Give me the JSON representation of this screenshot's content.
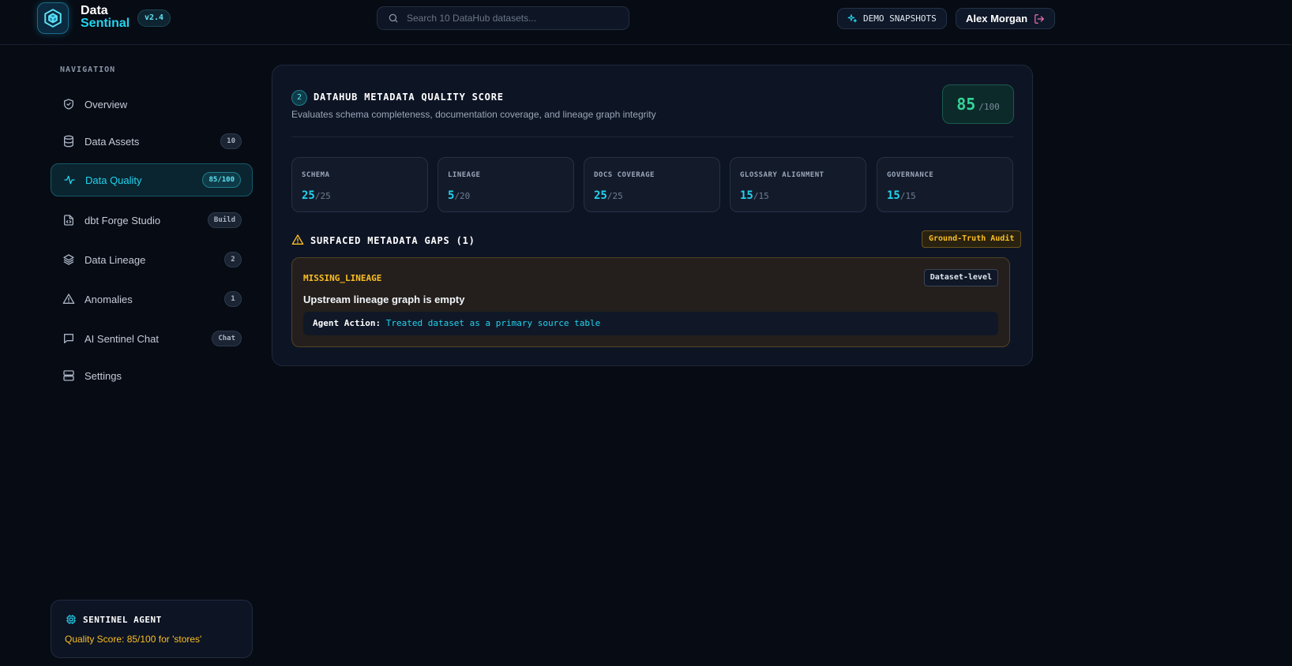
{
  "app": {
    "brand_line1": "Data",
    "brand_line2": "Sentinal",
    "version": "v2.4"
  },
  "search": {
    "placeholder": "Search 10 DataHub datasets..."
  },
  "header": {
    "demo_label": "DEMO SNAPSHOTS",
    "user_name": "Alex Morgan"
  },
  "sidebar": {
    "heading": "NAVIGATION",
    "items": [
      {
        "label": "Overview",
        "badge": "",
        "icon": "shield-icon"
      },
      {
        "label": "Data Assets",
        "badge": "10",
        "icon": "database-icon"
      },
      {
        "label": "Data Quality",
        "badge": "85/100",
        "icon": "activity-icon",
        "active": true
      },
      {
        "label": "dbt Forge Studio",
        "badge": "Build",
        "icon": "file-code-icon"
      },
      {
        "label": "Data Lineage",
        "badge": "2",
        "icon": "layers-icon"
      },
      {
        "label": "Anomalies",
        "badge": "1",
        "icon": "warning-icon"
      },
      {
        "label": "AI Sentinel Chat",
        "badge": "Chat",
        "icon": "chat-icon"
      },
      {
        "label": "Settings",
        "badge": "",
        "icon": "server-icon"
      }
    ],
    "agent": {
      "title": "SENTINEL AGENT",
      "status": "Quality Score: 85/100 for 'stores'"
    }
  },
  "main": {
    "step": "2",
    "title": "DATAHUB METADATA QUALITY SCORE",
    "subtitle": "Evaluates schema completeness, documentation coverage, and lineage graph integrity",
    "score": {
      "value": "85",
      "max": "/100"
    },
    "metrics": [
      {
        "label": "SCHEMA",
        "value": "25",
        "max": "/25"
      },
      {
        "label": "LINEAGE",
        "value": "5",
        "max": "/20"
      },
      {
        "label": "DOCS COVERAGE",
        "value": "25",
        "max": "/25"
      },
      {
        "label": "GLOSSARY ALIGNMENT",
        "value": "15",
        "max": "/15"
      },
      {
        "label": "GOVERNANCE",
        "value": "15",
        "max": "/15"
      }
    ],
    "gaps": {
      "title": "SURFACED METADATA GAPS (1)",
      "badge": "Ground-Truth Audit",
      "items": [
        {
          "code": "MISSING_LINEAGE",
          "level": "Dataset-level",
          "description": "Upstream lineage graph is empty",
          "action_label": "Agent Action:",
          "action_text": "Treated dataset as a primary source table"
        }
      ]
    }
  },
  "colors": {
    "accent": "#22d3ee",
    "success": "#34d399",
    "warning": "#fbbf24",
    "background": "#070b14"
  }
}
